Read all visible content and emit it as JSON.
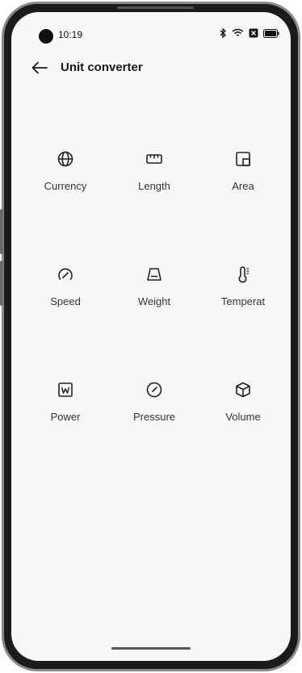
{
  "status_bar": {
    "time": "10:19",
    "icons": [
      "bluetooth-icon",
      "wifi-icon",
      "battery-saver-icon",
      "battery-icon"
    ]
  },
  "header": {
    "back_icon": "arrow-left-icon",
    "title": "Unit converter"
  },
  "converters": [
    {
      "label": "Currency",
      "icon": "globe-icon"
    },
    {
      "label": "Length",
      "icon": "ruler-icon"
    },
    {
      "label": "Area",
      "icon": "area-icon"
    },
    {
      "label": "Speed",
      "icon": "speedometer-icon"
    },
    {
      "label": "Weight",
      "icon": "weight-icon"
    },
    {
      "label": "Temperat",
      "icon": "thermometer-icon"
    },
    {
      "label": "Power",
      "icon": "watt-icon"
    },
    {
      "label": "Pressure",
      "icon": "gauge-icon"
    },
    {
      "label": "Volume",
      "icon": "cube-icon"
    }
  ],
  "colors": {
    "background": "#f7f7f7",
    "text": "#1a1a1a",
    "icon": "#222222"
  }
}
